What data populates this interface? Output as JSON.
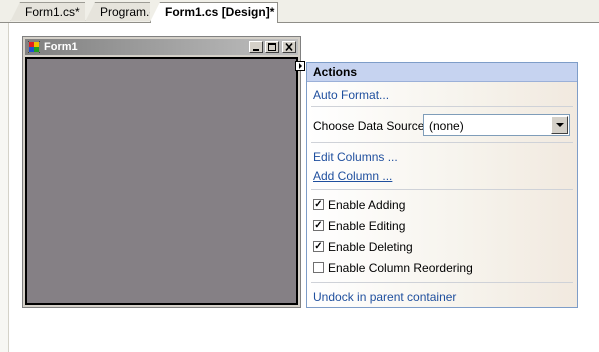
{
  "tabs": [
    {
      "label": "Form1.cs*",
      "active": false
    },
    {
      "label": "Program.cs",
      "active": false
    },
    {
      "label": "Form1.cs [Design]*",
      "active": true
    }
  ],
  "form": {
    "title": "Form1",
    "icon": "form-window-icon"
  },
  "actions_panel": {
    "header": "Actions",
    "auto_format": "Auto Format...",
    "data_source_label": "Choose Data Source",
    "data_source_value": "(none)",
    "edit_columns": "Edit Columns ...",
    "add_column": "Add Column ...",
    "checkboxes": [
      {
        "label": "Enable Adding",
        "checked": true
      },
      {
        "label": "Enable Editing",
        "checked": true
      },
      {
        "label": "Enable Deleting",
        "checked": true
      },
      {
        "label": "Enable Column Reordering",
        "checked": false
      }
    ],
    "undock": "Undock in parent container"
  },
  "colors": {
    "link": "#1f4f9e",
    "header_bg": "#c6d3f0",
    "grid_bg": "#858085",
    "titlebar_inactive": "#808080"
  }
}
